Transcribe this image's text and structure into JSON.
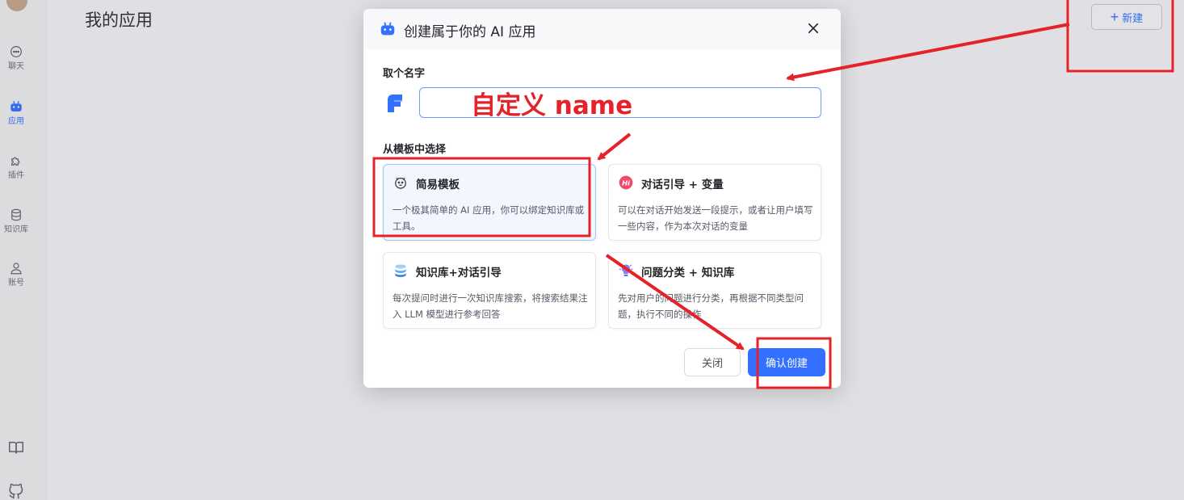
{
  "page": {
    "title": "我的应用"
  },
  "sidebar": {
    "items": [
      {
        "label": "聊天",
        "icon": "chat-bubble-icon"
      },
      {
        "label": "应用",
        "icon": "robot-icon",
        "active": true
      },
      {
        "label": "插件",
        "icon": "puzzle-icon"
      },
      {
        "label": "知识库",
        "icon": "database-icon"
      },
      {
        "label": "账号",
        "icon": "user-icon"
      }
    ],
    "bottom_icons": [
      "book-icon",
      "github-icon"
    ]
  },
  "toolbar": {
    "new_label": "新建"
  },
  "modal": {
    "title": "创建属于你的 AI 应用",
    "name_section_label": "取个名字",
    "name_input": {
      "value": "",
      "placeholder": ""
    },
    "template_section_label": "从模板中选择",
    "templates": [
      {
        "title": "简易模板",
        "desc": "一个极其简单的 AI 应用，你可以绑定知识库或工具。",
        "icon": "simple-template-icon",
        "selected": true
      },
      {
        "title": "对话引导 + 变量",
        "desc": "可以在对话开始发送一段提示，或者让用户填写一些内容，作为本次对话的变量",
        "icon": "hi-badge-icon",
        "selected": false
      },
      {
        "title": "知识库+对话引导",
        "desc": "每次提问时进行一次知识库搜索，将搜索结果注入 LLM 模型进行参考回答",
        "icon": "knowledge-stack-icon",
        "selected": false
      },
      {
        "title": "问题分类 + 知识库",
        "desc": "先对用户的问题进行分类，再根据不同类型问题，执行不同的操作",
        "icon": "classify-bulb-icon",
        "selected": false
      }
    ],
    "close_label": "关闭",
    "confirm_label": "确认创建"
  },
  "annotations": {
    "name_label": "自定义 name",
    "color": "#e5222a"
  },
  "colors": {
    "primary": "#3370ff",
    "annotation_red": "#e5222a"
  }
}
